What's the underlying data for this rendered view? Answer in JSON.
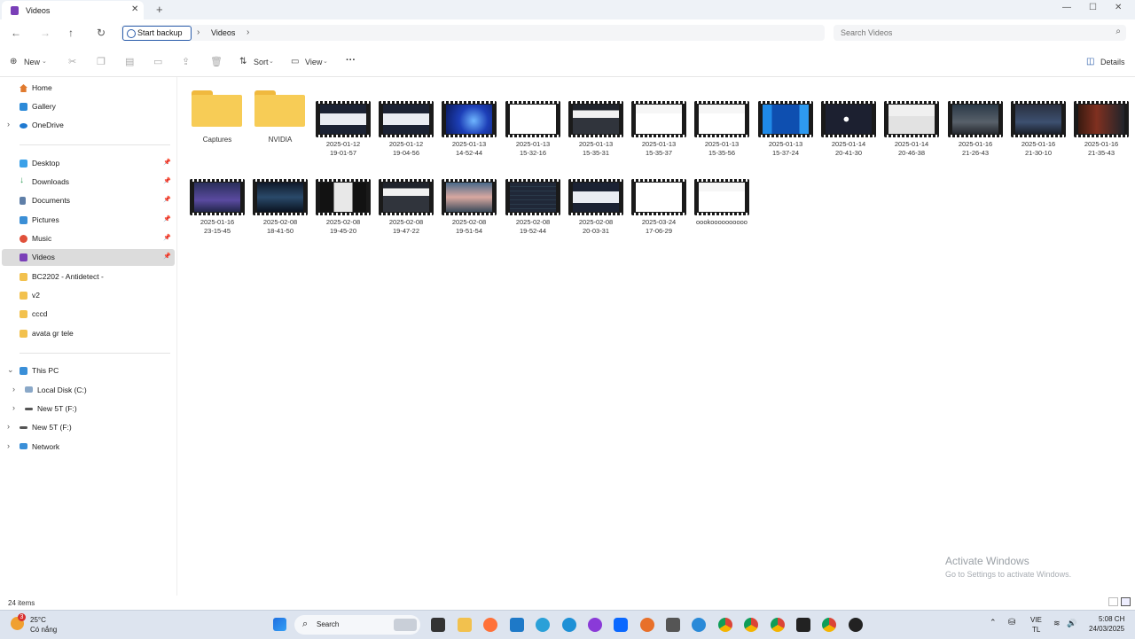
{
  "window": {
    "tab_title": "Videos",
    "tab_close": "✕",
    "new_tab": "+",
    "minimize": "—",
    "maximize": "☐",
    "close": "✕"
  },
  "address": {
    "backup_label": "Start backup",
    "separator": "›",
    "crumb": "Videos",
    "search_placeholder": "Search Videos"
  },
  "commands": {
    "new": "New",
    "sort": "Sort",
    "view": "View",
    "more": "···",
    "details": "Details"
  },
  "sidebar": {
    "home": "Home",
    "gallery": "Gallery",
    "onedrive": "OneDrive",
    "desktop": "Desktop",
    "downloads": "Downloads",
    "documents": "Documents",
    "pictures": "Pictures",
    "music": "Music",
    "videos": "Videos",
    "bc2202": "BC2202 - Antidetect -",
    "v2": "v2",
    "cccd": "cccd",
    "avata": "avata gr tele",
    "this_pc": "This PC",
    "local_disk": "Local Disk (C:)",
    "new5t_a": "New 5T (F:)",
    "new5t_b": "New 5T (F:)",
    "network": "Network"
  },
  "folders": [
    {
      "name": "Captures"
    },
    {
      "name": "NVIDIA"
    }
  ],
  "videos": [
    {
      "l1": "2025-01-12",
      "l2": "19-01-57",
      "theme": "dark-dialog"
    },
    {
      "l1": "2025-01-12",
      "l2": "19-04-56",
      "theme": "dark-dialog"
    },
    {
      "l1": "2025-01-13",
      "l2": "14-52-44",
      "theme": "blue-bloom"
    },
    {
      "l1": "2025-01-13",
      "l2": "15-32-16",
      "theme": "white"
    },
    {
      "l1": "2025-01-13",
      "l2": "15-35-31",
      "theme": "dark-page"
    },
    {
      "l1": "2025-01-13",
      "l2": "15-35-37",
      "theme": "white-page"
    },
    {
      "l1": "2025-01-13",
      "l2": "15-35-56",
      "theme": "white-page"
    },
    {
      "l1": "2025-01-13",
      "l2": "15-37-24",
      "theme": "blue-app"
    },
    {
      "l1": "2025-01-14",
      "l2": "20-41-30",
      "theme": "dark-small"
    },
    {
      "l1": "2025-01-14",
      "l2": "20-46-38",
      "theme": "white-dialog"
    },
    {
      "l1": "2025-01-16",
      "l2": "21-26-43",
      "theme": "game"
    },
    {
      "l1": "2025-01-16",
      "l2": "21-30-10",
      "theme": "car"
    },
    {
      "l1": "2025-01-16",
      "l2": "21-35-43",
      "theme": "game-red"
    },
    {
      "l1": "2025-01-16",
      "l2": "23-15-45",
      "theme": "car-purple"
    },
    {
      "l1": "2025-02-08",
      "l2": "18-41-50",
      "theme": "dark-blue"
    },
    {
      "l1": "2025-02-08",
      "l2": "19-45-20",
      "theme": "person"
    },
    {
      "l1": "2025-02-08",
      "l2": "19-47-22",
      "theme": "dark-page"
    },
    {
      "l1": "2025-02-08",
      "l2": "19-51-54",
      "theme": "photo"
    },
    {
      "l1": "2025-02-08",
      "l2": "19-52-44",
      "theme": "dark-lines"
    },
    {
      "l1": "2025-02-08",
      "l2": "20-03-31",
      "theme": "dark-dialog"
    },
    {
      "l1": "2025-03-24",
      "l2": "17-06-29",
      "theme": "white"
    },
    {
      "l1": "oookoooooooooo",
      "l2": "",
      "theme": "white-page"
    }
  ],
  "status": {
    "count": "24 items"
  },
  "watermark": {
    "line1": "Activate Windows",
    "line2": "Go to Settings to activate Windows."
  },
  "taskbar": {
    "weather_temp": "25°C",
    "weather_desc": "Có nắng",
    "weather_badge": "3",
    "search_label": "Search",
    "lang1": "VIE",
    "lang2": "TL",
    "time": "5:08 CH",
    "date": "24/03/2025"
  },
  "colors": {
    "accent": "#2a5caa",
    "folder": "#f7cc56",
    "selection": "#dcdcdc",
    "taskbar": "#dde4ef"
  }
}
